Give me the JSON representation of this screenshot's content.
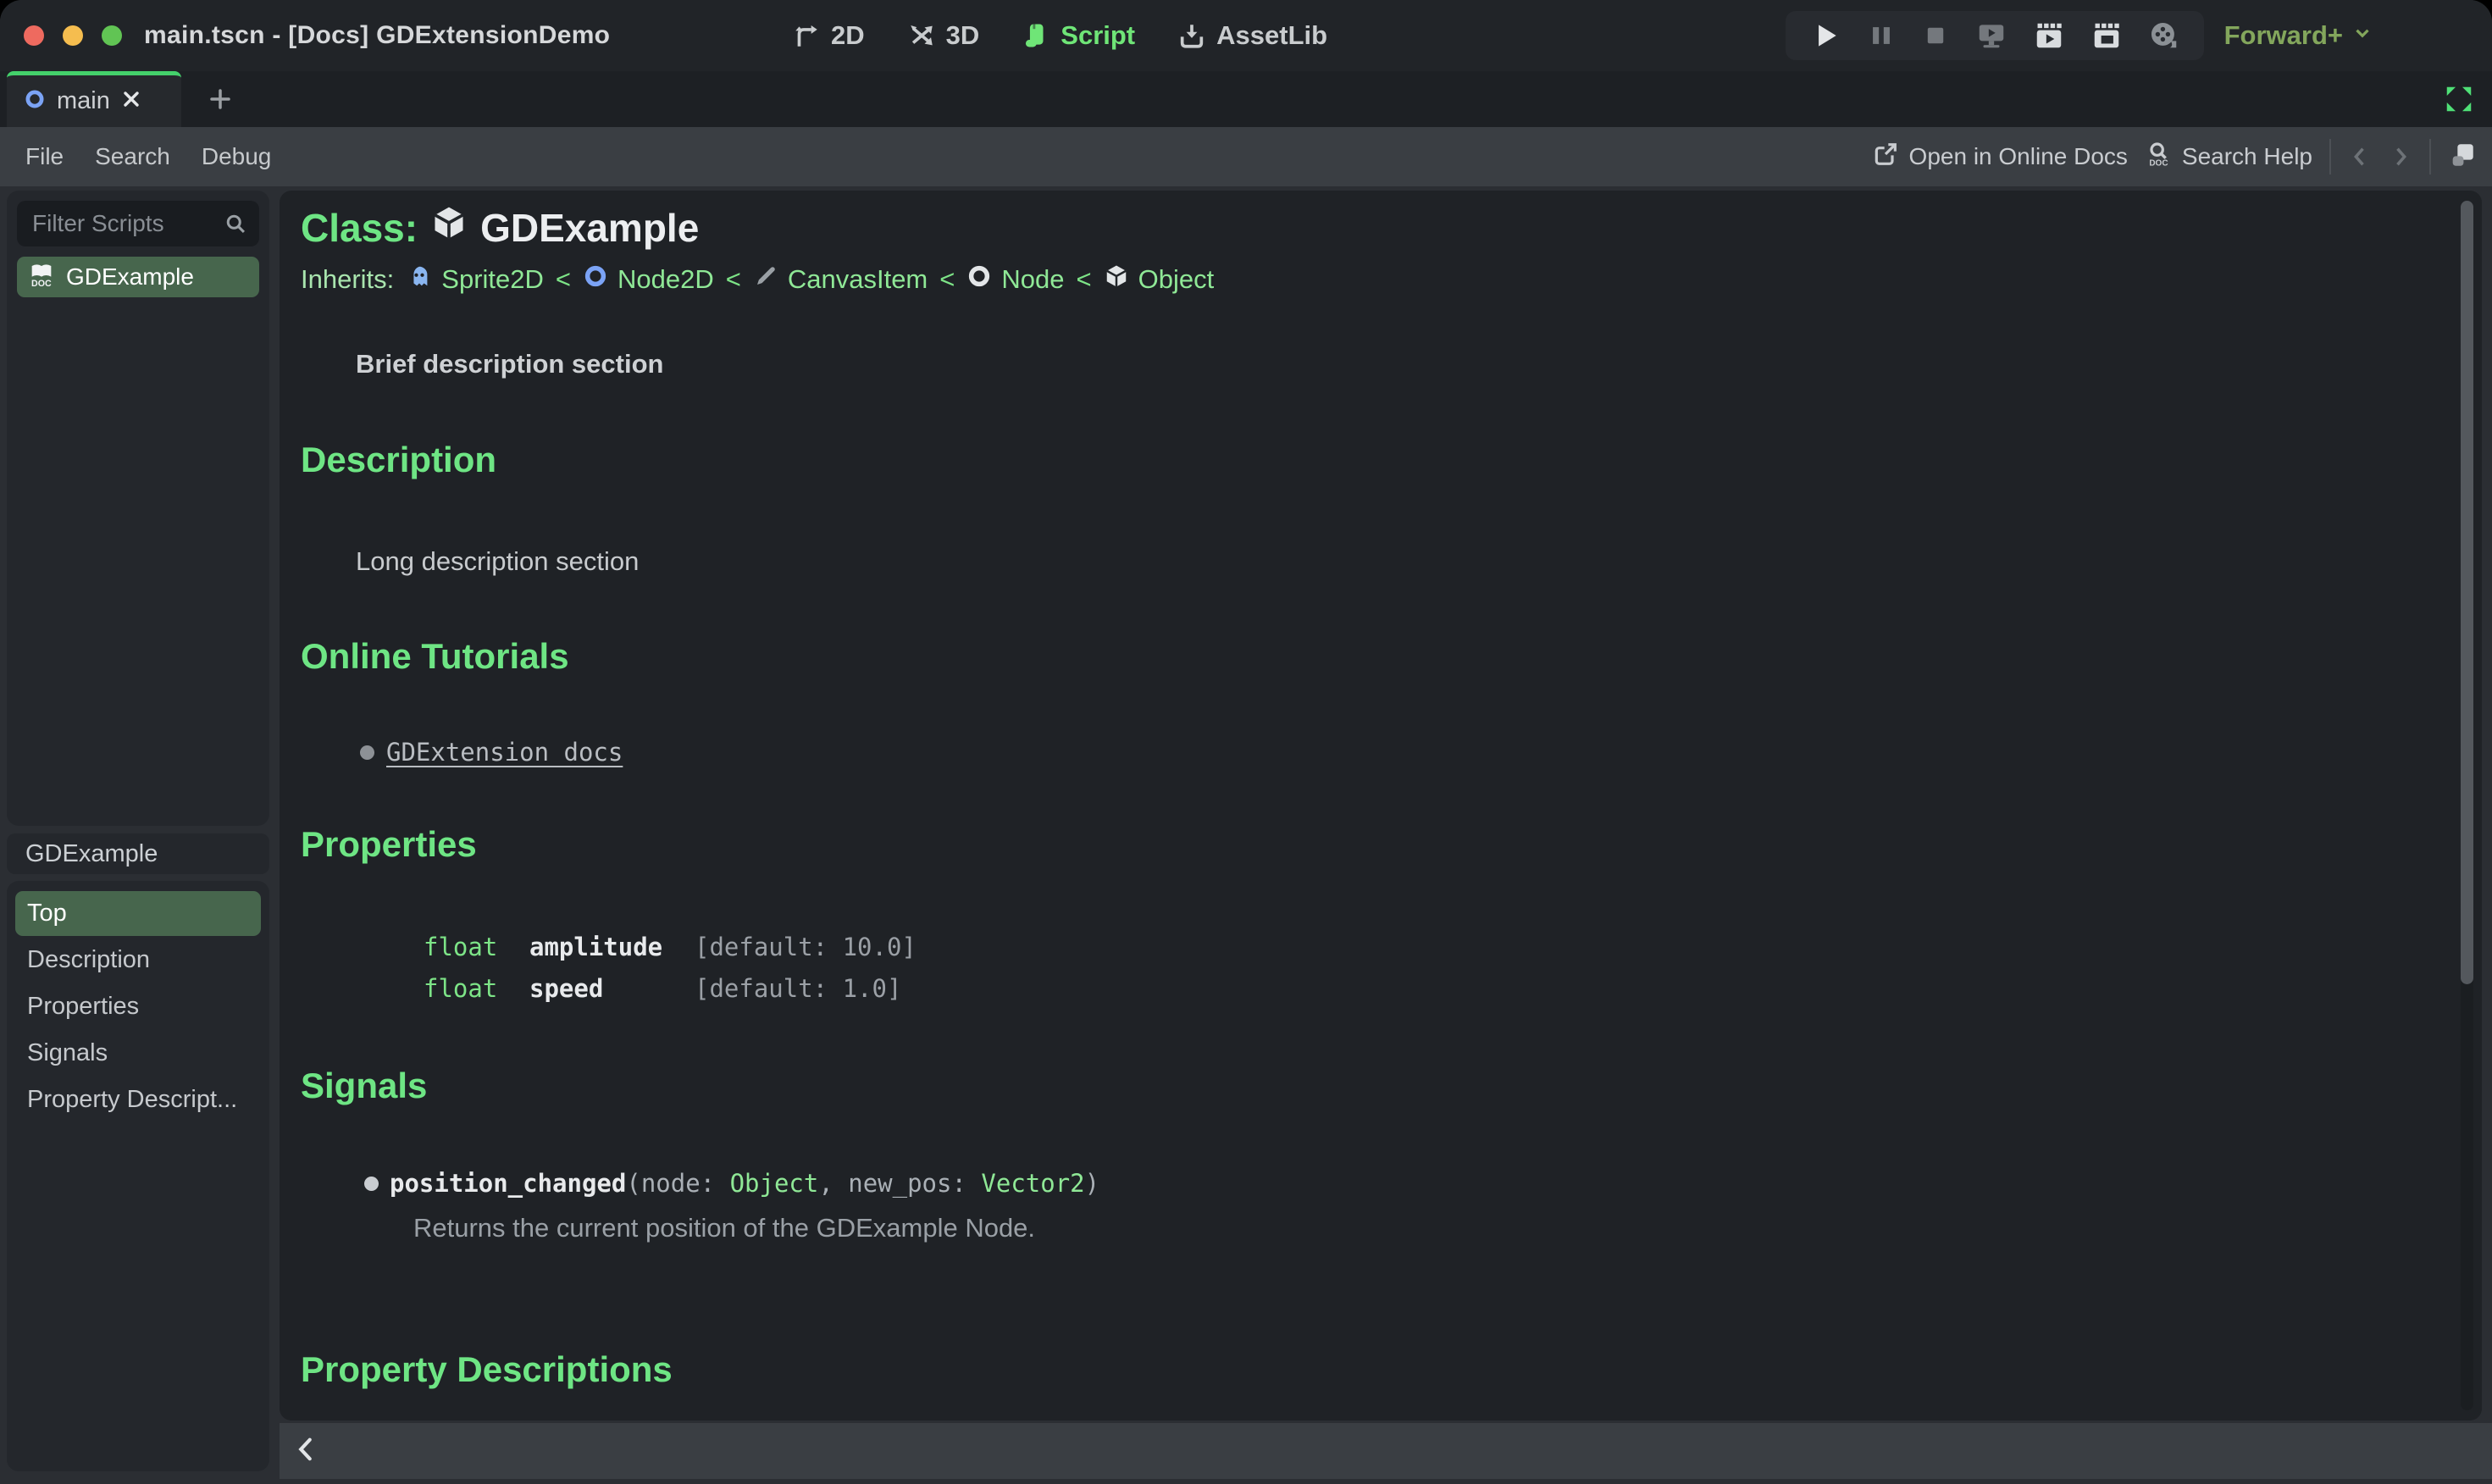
{
  "titlebar": {
    "title": "main.tscn - [Docs] GDExtensionDemo",
    "workspaces": [
      {
        "label": "2D",
        "active": false
      },
      {
        "label": "3D",
        "active": false
      },
      {
        "label": "Script",
        "active": true
      },
      {
        "label": "AssetLib",
        "active": false
      }
    ],
    "renderer": "Forward+"
  },
  "tabbar": {
    "tabs": [
      {
        "label": "main",
        "active": true
      }
    ]
  },
  "menubar": {
    "items": [
      "File",
      "Search",
      "Debug"
    ],
    "online_docs_label": "Open in Online Docs",
    "search_help_label": "Search Help"
  },
  "sidebar": {
    "filter_placeholder": "Filter Scripts",
    "scripts": [
      {
        "name": "GDExample",
        "selected": true
      }
    ],
    "class_label": "GDExample",
    "sections": [
      {
        "label": "Top",
        "selected": true
      },
      {
        "label": "Description",
        "selected": false
      },
      {
        "label": "Properties",
        "selected": false
      },
      {
        "label": "Signals",
        "selected": false
      },
      {
        "label": "Property Descript...",
        "selected": false
      }
    ]
  },
  "doc": {
    "class_label": "Class:",
    "class_name": "GDExample",
    "inherits_label": "Inherits:",
    "separator": "<",
    "inherits": [
      {
        "name": "Sprite2D",
        "icon": "sprite2d-icon"
      },
      {
        "name": "Node2D",
        "icon": "node2d-icon"
      },
      {
        "name": "CanvasItem",
        "icon": "canvasitem-icon"
      },
      {
        "name": "Node",
        "icon": "node-icon"
      },
      {
        "name": "Object",
        "icon": "object-icon"
      }
    ],
    "brief": "Brief description section",
    "description_title": "Description",
    "description_body": "Long description section",
    "tutorials_title": "Online Tutorials",
    "tutorial_link": "GDExtension docs",
    "properties_title": "Properties",
    "properties": {
      "rows": [
        {
          "type": "float",
          "name": "amplitude",
          "default": "[default: 10.0]"
        },
        {
          "type": "float",
          "name": "speed",
          "default": "[default: 1.0]"
        }
      ]
    },
    "signals_title": "Signals",
    "signal": {
      "name": "position_changed",
      "open": "(node: ",
      "type1": "Object",
      "mid": ", new_pos: ",
      "type2": "Vector2",
      "close": ")",
      "description": "Returns the current position of the GDExample Node."
    },
    "property_descriptions_title": "Property Descriptions"
  },
  "colors": {
    "accent_green": "#6ee584",
    "selected_green": "#47664d",
    "link_green": "#8fe896",
    "tab_border_green": "#44d16b",
    "renderer_green": "#83a65c",
    "node_blue": "#7ba3f5"
  },
  "icons": {
    "traffic-lights": "red/yellow/green circles",
    "workspace-2d-icon": "elbow arrow",
    "workspace-3d-icon": "crossed axis arrows",
    "script-icon": "green scroll",
    "assetlib-icon": "download tray",
    "play-icon": "triangle",
    "pause-icon": "double bars",
    "stop-icon": "square",
    "play-scene-icon": "monitor with play",
    "play-movie-icon": "clapperboard with play",
    "play-custom-icon": "clapperboard",
    "movie-maker-icon": "film reel",
    "renderer-chevron-icon": "chevron down",
    "node2d-icon": "blue ring",
    "close-icon": "x",
    "add-tab-icon": "plus",
    "expand-icon": "four green arrows",
    "external-link-icon": "square with arrow",
    "search-help-icon": "magnifier over DOC",
    "back-icon": "chevron left",
    "forward-icon": "chevron right",
    "panel-toggle-icon": "stacked squares",
    "search-icon": "magnifier",
    "doc-book-icon": "open book DOC",
    "object-icon": "white cube",
    "sprite2d-icon": "blue ghost face",
    "canvasitem-icon": "gray brush",
    "node-icon": "white ring",
    "collapse-left-icon": "chevron left"
  }
}
